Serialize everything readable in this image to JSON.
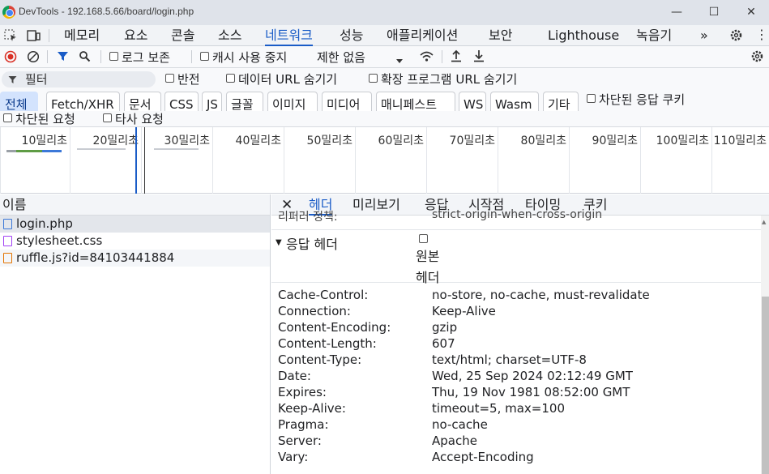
{
  "window": {
    "title": "DevTools - 192.168.5.66/board/login.php",
    "minimize": "—",
    "maximize": "☐",
    "close": "✕"
  },
  "main_tabs": [
    "메모리",
    "요소",
    "콘솔",
    "소스",
    "네트워크",
    "성능",
    "애플리케이션",
    "보안",
    "Lighthouse",
    "녹음기"
  ],
  "more_tabs": "»",
  "toolbar": {
    "preserve_log": "로그 보존",
    "disable_cache": "캐시 사용 중지",
    "throttling": "제한 없음"
  },
  "filter": {
    "placeholder": "필터",
    "invert": "반전",
    "hide_data_urls": "데이터 URL 숨기기",
    "hide_extension_urls": "확장 프로그램 URL 숨기기"
  },
  "type_chips": [
    "전체",
    "Fetch/XHR",
    "문서",
    "CSS",
    "JS",
    "글꼴",
    "이미지",
    "미디어",
    "매니페스트",
    "WS",
    "Wasm",
    "기타"
  ],
  "blocked_cookies": "차단된 응답 쿠키",
  "blocked_requests": "차단된 요청",
  "third_party": "타사 요청",
  "timeline_ticks": [
    "10밀리초",
    "20밀리초",
    "30밀리초",
    "40밀리초",
    "50밀리초",
    "60밀리초",
    "70밀리초",
    "80밀리초",
    "90밀리초",
    "100밀리초",
    "110밀리초"
  ],
  "request_list": {
    "header": "이름",
    "items": [
      "login.php",
      "stylesheet.css",
      "ruffle.js?id=84103441884"
    ]
  },
  "detail_tabs": [
    "헤더",
    "미리보기",
    "응답",
    "시작점",
    "타이밍",
    "쿠키"
  ],
  "clipped_row": {
    "name": "리퍼러 정책:",
    "value": "strict-origin-when-cross-origin"
  },
  "response_headers": {
    "title": "응답 헤더",
    "raw_label_1": "원본",
    "raw_label_2": "헤더",
    "rows": [
      {
        "name": "Cache-Control:",
        "value": "no-store, no-cache, must-revalidate"
      },
      {
        "name": "Connection:",
        "value": "Keep-Alive"
      },
      {
        "name": "Content-Encoding:",
        "value": "gzip"
      },
      {
        "name": "Content-Length:",
        "value": "607"
      },
      {
        "name": "Content-Type:",
        "value": "text/html; charset=UTF-8"
      },
      {
        "name": "Date:",
        "value": "Wed, 25 Sep 2024 02:12:49 GMT"
      },
      {
        "name": "Expires:",
        "value": "Thu, 19 Nov 1981 08:52:00 GMT"
      },
      {
        "name": "Keep-Alive:",
        "value": "timeout=5, max=100"
      },
      {
        "name": "Pragma:",
        "value": "no-cache"
      },
      {
        "name": "Server:",
        "value": "Apache"
      },
      {
        "name": "Vary:",
        "value": "Accept-Encoding"
      }
    ]
  },
  "colors": {
    "accent": "#1a5cc7",
    "record_stop": "#d93025"
  }
}
